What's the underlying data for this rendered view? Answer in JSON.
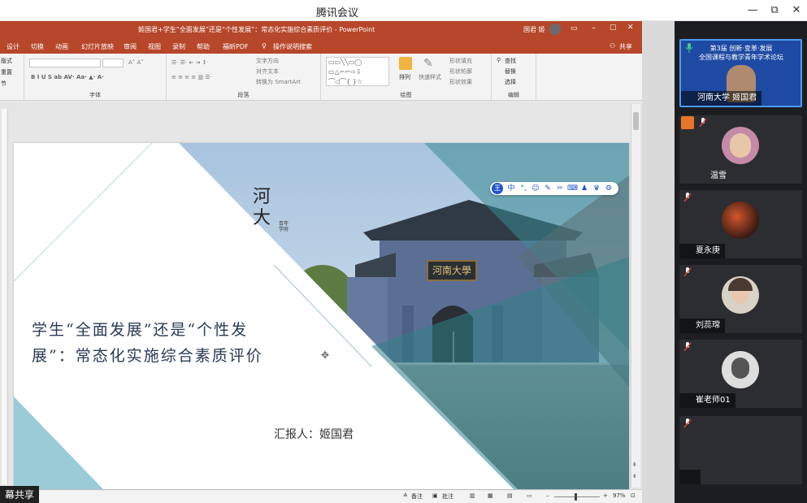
{
  "window": {
    "title": "腾讯会议",
    "buttons": [
      "—",
      "⧉",
      "✕"
    ]
  },
  "share": {
    "label": "幕共享"
  },
  "powerpoint": {
    "doc_title": "姬国君+学生“全面发展”还是“个性发展”：常态化实施综合素质评价 - PowerPoint",
    "user_name": "国君 姬",
    "share_button": "共享",
    "tabs": [
      "设计",
      "切换",
      "动画",
      "幻灯片放映",
      "审阅",
      "视图",
      "录制",
      "帮助",
      "福昕PDF",
      "操作说明搜索"
    ],
    "ribbon": {
      "left_items": [
        "版式",
        "重置",
        "节"
      ],
      "font_label": "字体",
      "paragraph_label": "段落",
      "paragraph_items": [
        "文字方向",
        "对齐文本",
        "转换为 SmartArt"
      ],
      "drawing_label": "绘图",
      "drawing_items": [
        "排列",
        "快速样式",
        "形状填充",
        "形状轮廓",
        "形状效果"
      ],
      "edit_label": "编辑",
      "edit_items": [
        "查找",
        "替换",
        "选择"
      ]
    },
    "status": {
      "notes": "备注",
      "comments": "批注",
      "zoom": "97%"
    }
  },
  "slide": {
    "logo_text": "河大",
    "logo_small": "百年学府",
    "gate_sign": "河南大學",
    "title_line1": "学生“全面发展”还是“个性发",
    "title_line2": "展”：常态化实施综合素质评价",
    "reporter": "汇报人：姬国君",
    "ime_keys": [
      "中",
      "°,",
      "☺",
      "✎",
      "✂",
      "⌨",
      "♟",
      "♛",
      "⚙"
    ],
    "ime_brand": "王"
  },
  "participants": [
    {
      "name": "河南大学 姬国君",
      "active": true,
      "banner_lines": [
        "第3届 创新·变革·发展",
        "全国课程与教学青年学术论坛"
      ]
    },
    {
      "name": "温雪",
      "active": false
    },
    {
      "name": "夏永庚",
      "active": false
    },
    {
      "name": "刘蕊瑺",
      "active": false
    },
    {
      "name": "崔老师01",
      "active": false
    },
    {
      "name": "",
      "active": false
    }
  ],
  "colors": {
    "ppt_red": "#b7472a",
    "panel_bg": "#1c1d21",
    "active_border": "#4b9bf2",
    "teal": "#3b8a94"
  }
}
